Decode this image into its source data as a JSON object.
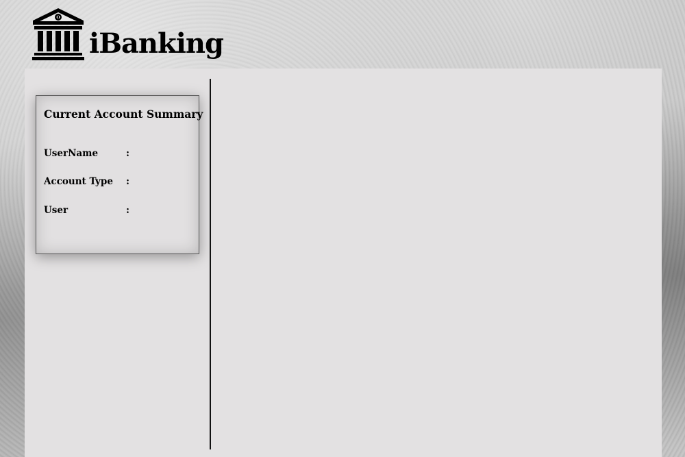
{
  "app": {
    "name": "iBanking",
    "logo_icon": "bank-building-icon"
  },
  "summary": {
    "title": "Current Account Summary",
    "rows": [
      {
        "label": "UserName",
        "separator": ":",
        "value": ""
      },
      {
        "label": "Account Type",
        "separator": ":",
        "value": ""
      },
      {
        "label": "User",
        "separator": ":",
        "value": ""
      }
    ]
  },
  "colors": {
    "panel_background": "#e3e1e2",
    "divider": "#111111",
    "text": "#000000"
  }
}
